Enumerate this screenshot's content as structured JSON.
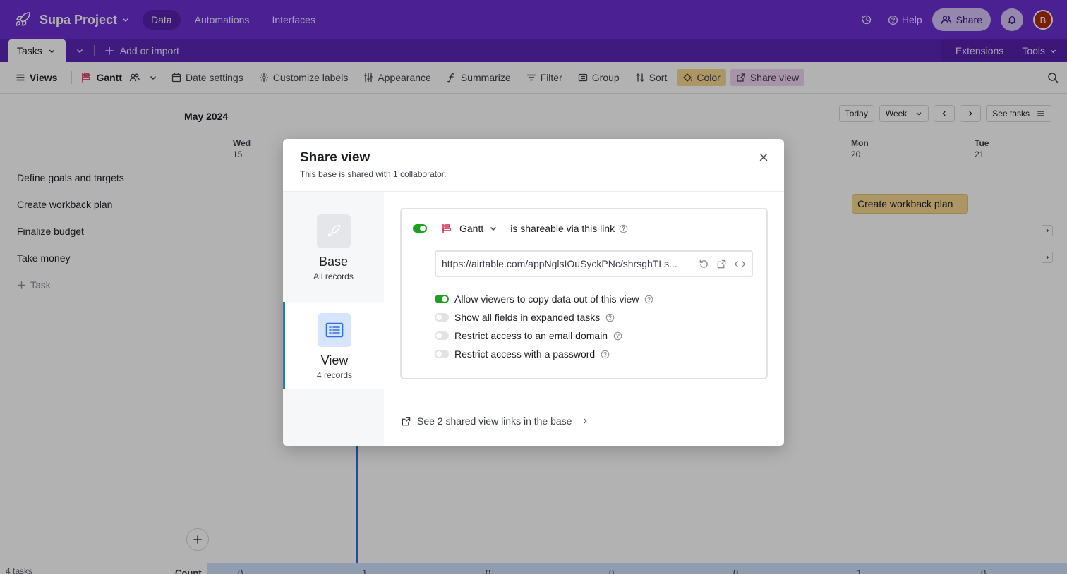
{
  "topbar": {
    "project_name": "Supa Project",
    "nav": [
      "Data",
      "Automations",
      "Interfaces"
    ],
    "help_label": "Help",
    "share_label": "Share",
    "avatar_initial": "B",
    "brand_color": "#6b2fd1"
  },
  "tabbar": {
    "active_table": "Tasks",
    "add_import_label": "Add or import",
    "extensions_label": "Extensions",
    "tools_label": "Tools"
  },
  "viewbar": {
    "views_label": "Views",
    "current_view": "Gantt",
    "date_settings": "Date settings",
    "customize_labels": "Customize labels",
    "appearance": "Appearance",
    "summarize": "Summarize",
    "filter": "Filter",
    "group": "Group",
    "sort": "Sort",
    "color": "Color",
    "share_view": "Share view"
  },
  "records": {
    "items": [
      "Define goals and targets",
      "Create workback plan",
      "Finalize budget",
      "Take money"
    ],
    "add_label": "Task",
    "footer": "4 tasks"
  },
  "gantt": {
    "month": "May 2024",
    "controls": {
      "today": "Today",
      "week": "Week",
      "see_tasks": "See tasks"
    },
    "days": [
      {
        "dow": "Wed",
        "date": "15"
      },
      {
        "dow": "Mon",
        "date": "20"
      },
      {
        "dow": "Tue",
        "date": "21"
      }
    ],
    "bar_label": "Create workback plan",
    "count_label": "Count",
    "counts": [
      "0",
      "1",
      "0",
      "0",
      "0",
      "1",
      "0"
    ]
  },
  "modal": {
    "title": "Share view",
    "subtitle": "This base is shared with 1 collaborator.",
    "options": [
      {
        "name": "Base",
        "desc": "All records"
      },
      {
        "name": "View",
        "desc": "4 records"
      }
    ],
    "view_name": "Gantt",
    "shareable_text": "is shareable via this link",
    "link_url": "https://airtable.com/appNglsIOuSyckPNc/shrsghTLs...",
    "settings": [
      {
        "label": "Allow viewers to copy data out of this view",
        "on": true
      },
      {
        "label": "Show all fields in expanded tasks",
        "on": false
      },
      {
        "label": "Restrict access to an email domain",
        "on": false
      },
      {
        "label": "Restrict access with a password",
        "on": false
      }
    ],
    "footer_link": "See 2 shared view links in the base"
  }
}
